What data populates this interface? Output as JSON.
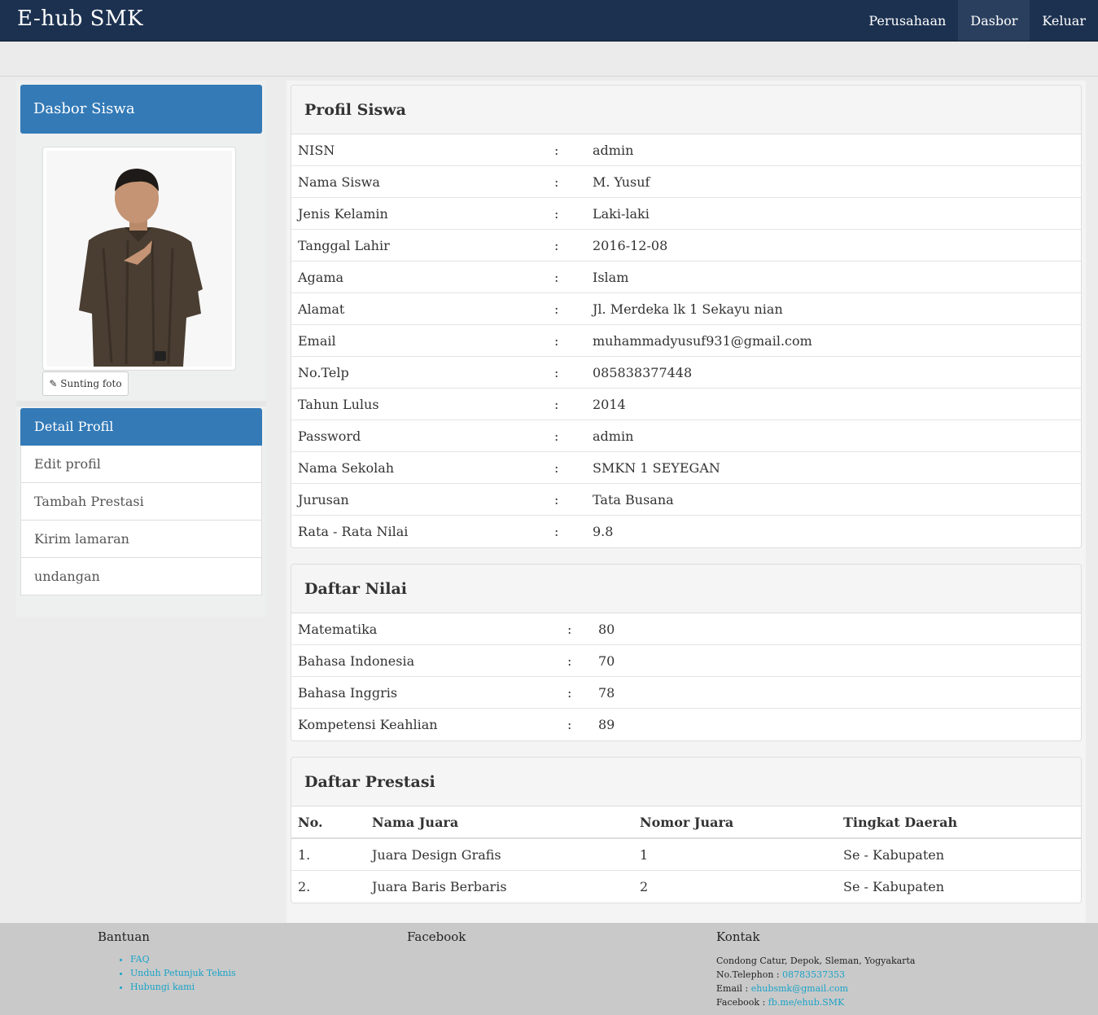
{
  "navbar": {
    "brand": "E-hub SMK",
    "links": [
      {
        "label": "Perusahaan",
        "active": false
      },
      {
        "label": "Dasbor",
        "active": true
      },
      {
        "label": "Keluar",
        "active": false
      }
    ]
  },
  "sidebar": {
    "title": "Dasbor Siswa",
    "edit_photo_label": "Sunting foto",
    "menu": [
      {
        "label": "Detail Profil",
        "active": true
      },
      {
        "label": "Edit profil",
        "active": false
      },
      {
        "label": "Tambah Prestasi",
        "active": false
      },
      {
        "label": "Kirim lamaran",
        "active": false
      },
      {
        "label": "undangan",
        "active": false
      }
    ]
  },
  "profile": {
    "title": "Profil Siswa",
    "rows": [
      {
        "label": "NISN",
        "value": "admin"
      },
      {
        "label": "Nama Siswa",
        "value": "M. Yusuf"
      },
      {
        "label": "Jenis Kelamin",
        "value": "Laki-laki"
      },
      {
        "label": "Tanggal Lahir",
        "value": "2016-12-08"
      },
      {
        "label": "Agama",
        "value": "Islam"
      },
      {
        "label": "Alamat",
        "value": "Jl. Merdeka lk 1 Sekayu nian"
      },
      {
        "label": "Email",
        "value": "muhammadyusuf931@gmail.com"
      },
      {
        "label": "No.Telp",
        "value": "085838377448"
      },
      {
        "label": "Tahun Lulus",
        "value": "2014"
      },
      {
        "label": "Password",
        "value": "admin"
      },
      {
        "label": "Nama Sekolah",
        "value": "SMKN 1 SEYEGAN"
      },
      {
        "label": "Jurusan",
        "value": "Tata Busana"
      },
      {
        "label": "Rata - Rata Nilai",
        "value": "9.8"
      }
    ]
  },
  "grades": {
    "title": "Daftar Nilai",
    "rows": [
      {
        "label": "Matematika",
        "value": "80"
      },
      {
        "label": "Bahasa Indonesia",
        "value": "70"
      },
      {
        "label": "Bahasa Inggris",
        "value": "78"
      },
      {
        "label": "Kompetensi Keahlian",
        "value": "89"
      }
    ]
  },
  "achievements": {
    "title": "Daftar Prestasi",
    "headers": [
      "No.",
      "Nama Juara",
      "Nomor Juara",
      "Tingkat Daerah"
    ],
    "rows": [
      [
        "1.",
        "Juara Design Grafis",
        "1",
        "Se - Kabupaten"
      ],
      [
        "2.",
        "Juara Baris Berbaris",
        "2",
        "Se - Kabupaten"
      ]
    ]
  },
  "footer": {
    "help_title": "Bantuan",
    "help_links": [
      "FAQ",
      "Unduh Petunjuk Teknis",
      "Hubungi kami"
    ],
    "facebook_title": "Facebook",
    "contact_title": "Kontak",
    "address": "Condong Catur, Depok, Sleman, Yogyakarta",
    "phone_label": "No.Telephon :",
    "phone": "08783537353",
    "email_label": "Email :",
    "email": "ehubsmk@gmail.com",
    "facebook_label": "Facebook :",
    "facebook": "fb.me/ehub.SMK"
  },
  "colors": {
    "navbar": "#1c3150",
    "primary": "#337ab7",
    "link": "#1aa3c8",
    "footer": "#c9c9c9"
  }
}
